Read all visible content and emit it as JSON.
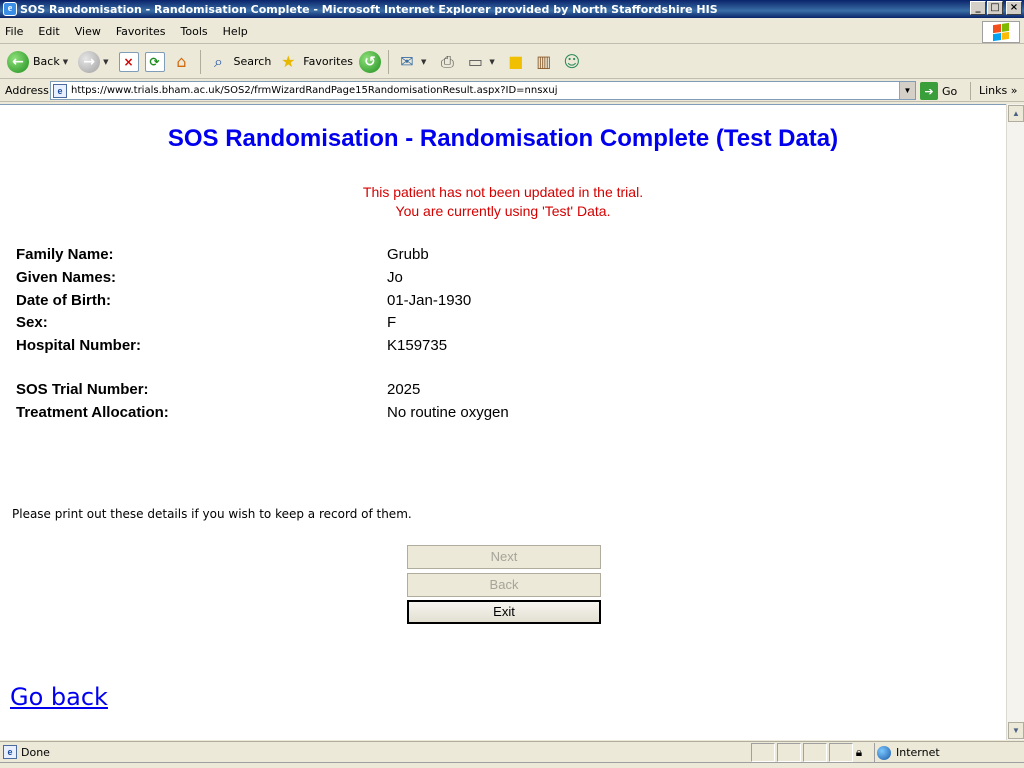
{
  "window": {
    "title": "SOS Randomisation - Randomisation Complete - Microsoft Internet Explorer provided by North Staffordshire HIS",
    "app_icon": "ie-icon",
    "minimize_label": "_",
    "maximize_label": "□",
    "close_label": "×"
  },
  "menu": [
    "File",
    "Edit",
    "View",
    "Favorites",
    "Tools",
    "Help"
  ],
  "toolbar": {
    "back_label": "Back",
    "search_label": "Search",
    "favorites_label": "Favorites"
  },
  "address": {
    "label": "Address",
    "url": "https://www.trials.bham.ac.uk/SOS2/frmWizardRandPage15RandomisationResult.aspx?ID=nnsxuj",
    "go_label": "Go",
    "links_label": "Links"
  },
  "page": {
    "heading": "SOS Randomisation - Randomisation Complete (Test Data)",
    "warning_line1": "This patient has not been updated in the trial.",
    "warning_line2": "You are currently using 'Test' Data.",
    "fields": {
      "family_name": {
        "label": "Family Name:",
        "value": "Grubb"
      },
      "given_names": {
        "label": "Given Names:",
        "value": "Jo"
      },
      "dob": {
        "label": "Date of Birth:",
        "value": "01-Jan-1930"
      },
      "sex": {
        "label": "Sex:",
        "value": "F"
      },
      "hospital_number": {
        "label": "Hospital Number:",
        "value": "K159735"
      },
      "trial_number": {
        "label": "SOS Trial Number:",
        "value": "2025"
      },
      "allocation": {
        "label": "Treatment Allocation:",
        "value": "No routine oxygen"
      }
    },
    "note": "Please print out these details if you wish to keep a record of them.",
    "buttons": {
      "next": "Next",
      "back": "Back",
      "exit": "Exit"
    },
    "go_back_link": "Go back"
  },
  "status": {
    "text": "Done",
    "zone": "Internet"
  },
  "colors": {
    "heading": "#0000ee",
    "warning": "#d40000",
    "link": "#0000ee",
    "chrome": "#ece9d8",
    "titlebar": "#0a246a"
  }
}
